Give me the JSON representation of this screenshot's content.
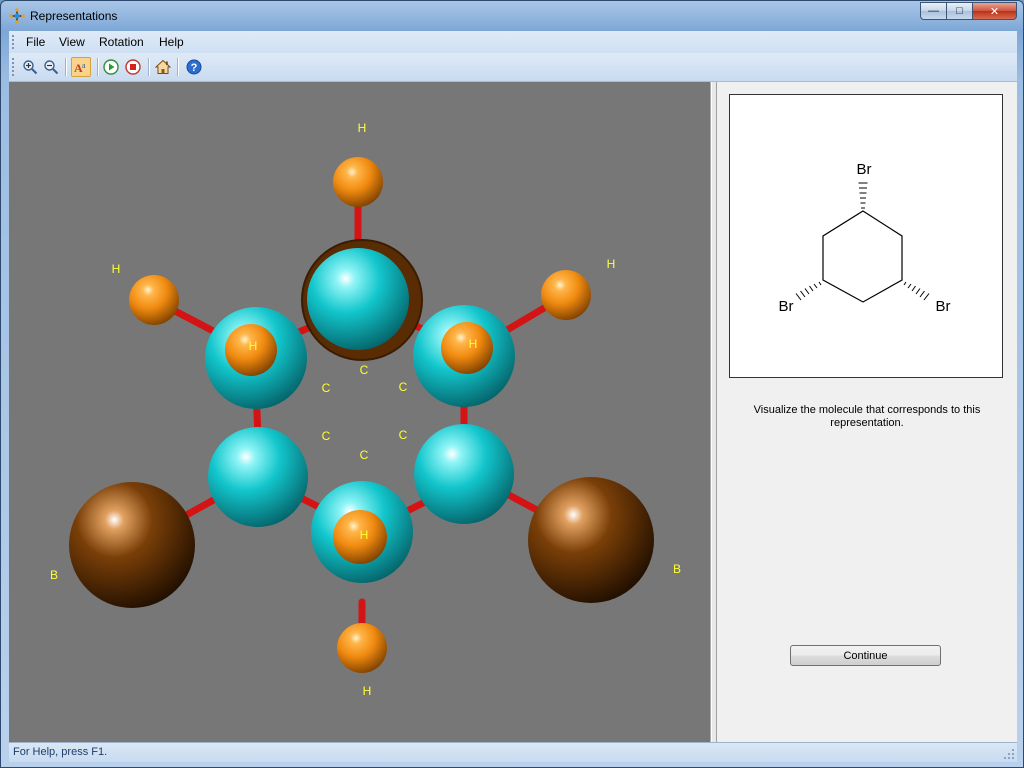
{
  "window": {
    "title": "Representations",
    "controls": {
      "minimize": "—",
      "maximize": "□",
      "close": "✕"
    }
  },
  "menu": {
    "items": [
      {
        "label": "File"
      },
      {
        "label": "View"
      },
      {
        "label": "Rotation"
      },
      {
        "label": "Help"
      }
    ]
  },
  "toolbar": {
    "buttons": [
      {
        "icon": "zoom-in-icon"
      },
      {
        "icon": "zoom-out-icon"
      },
      {
        "icon": "atom-labels-icon",
        "active": true
      },
      {
        "icon": "play-icon"
      },
      {
        "icon": "stop-icon"
      },
      {
        "icon": "home-icon"
      },
      {
        "icon": "help-icon"
      }
    ]
  },
  "molecule_view": {
    "atom_labels": {
      "h_top": "H",
      "h_left": "H",
      "h_right": "H",
      "h_bottom": "H",
      "h_center_left": "H",
      "h_center_right": "H",
      "h_center_bottom": "H",
      "c1": "C",
      "c2": "C",
      "c3": "C",
      "c4": "C",
      "c5": "C",
      "c6": "C",
      "br_left": "B",
      "br_right": "B"
    },
    "colors": {
      "background": "#777777",
      "carbon": "#12c6cc",
      "hydrogen": "#f08a10",
      "bromine": "#7a3f08",
      "bond": "#d41414",
      "label": "#ffff33"
    }
  },
  "structure": {
    "labels": {
      "top": "Br",
      "left": "Br",
      "right": "Br"
    }
  },
  "panel": {
    "instruction": "Visualize the molecule that corresponds to this representation.",
    "continue_label": "Continue"
  },
  "status": {
    "text": "For Help, press F1."
  }
}
